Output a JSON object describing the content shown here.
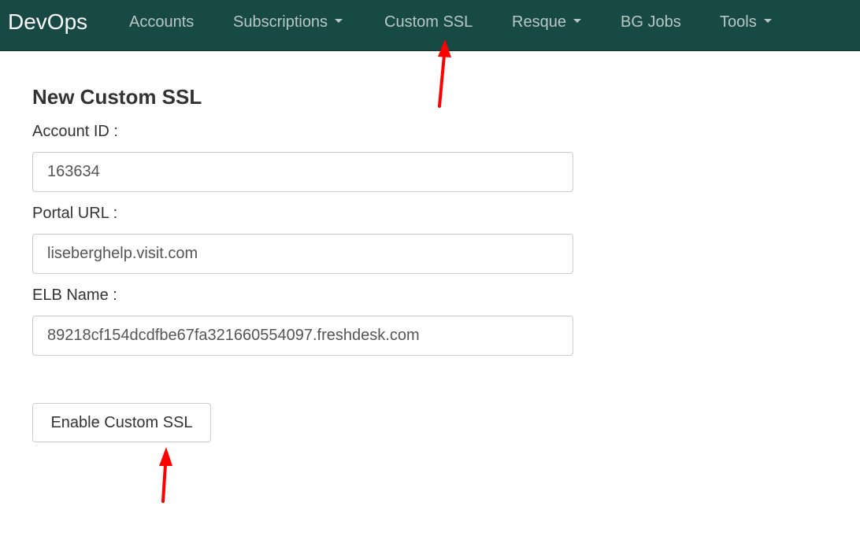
{
  "navbar": {
    "brand": "DevOps",
    "items": [
      {
        "label": "Accounts",
        "has_dropdown": false
      },
      {
        "label": "Subscriptions",
        "has_dropdown": true
      },
      {
        "label": "Custom SSL",
        "has_dropdown": false
      },
      {
        "label": "Resque",
        "has_dropdown": true
      },
      {
        "label": "BG Jobs",
        "has_dropdown": false
      },
      {
        "label": "Tools",
        "has_dropdown": true
      }
    ],
    "background_color": "#184a45",
    "text_color": "#b9c7c4"
  },
  "form": {
    "title": "New Custom SSL",
    "account_id": {
      "label": "Account ID :",
      "value": "163634"
    },
    "portal_url": {
      "label": "Portal URL :",
      "value": "liseberghelp.visit.com"
    },
    "elb_name": {
      "label": "ELB Name :",
      "value": "89218cf154dcdfbe67fa321660554097.freshdesk.com"
    },
    "submit_label": "Enable Custom SSL"
  },
  "annotations": {
    "arrow_color": "#ff0000"
  }
}
